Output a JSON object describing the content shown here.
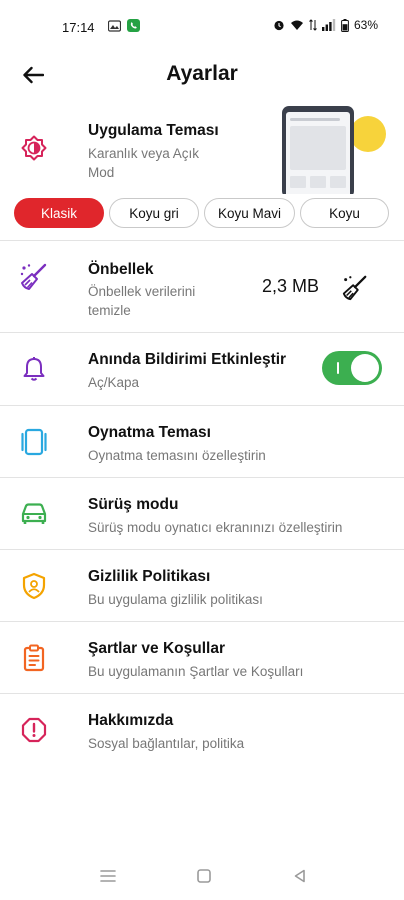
{
  "status_bar": {
    "time": "17:14",
    "battery": "63%"
  },
  "header": {
    "title": "Ayarlar"
  },
  "theme": {
    "title": "Uygulama Teması",
    "subtitle": "Karanlık veya Açık Mod",
    "options": [
      "Klasik",
      "Koyu gri",
      "Koyu Mavi",
      "Koyu"
    ],
    "selected": "Klasik"
  },
  "cache": {
    "title": "Önbellek",
    "subtitle": "Önbellek verilerini temizle",
    "size": "2,3 MB"
  },
  "notifications": {
    "title": "Anında Bildirimi Etkinleştir",
    "subtitle": "Aç/Kapa",
    "enabled": true
  },
  "items": [
    {
      "title": "Oynatma Teması",
      "subtitle": "Oynatma temasını özelleştirin",
      "icon": "player-theme-icon",
      "color": "#29a8e0"
    },
    {
      "title": "Sürüş modu",
      "subtitle": "Sürüş modu oynatıcı ekranınızı özelleştirin",
      "icon": "car-icon",
      "color": "#3caf50"
    },
    {
      "title": "Gizlilik Politikası",
      "subtitle": "Bu uygulama gizlilik politikası",
      "icon": "shield-user-icon",
      "color": "#f4a300"
    },
    {
      "title": "Şartlar ve Koşullar",
      "subtitle": "Bu uygulamanın Şartlar ve Koşulları",
      "icon": "clipboard-icon",
      "color": "#f26522"
    },
    {
      "title": "Hakkımızda",
      "subtitle": "Sosyal bağlantılar, politika",
      "icon": "info-octagon-icon",
      "color": "#d6245a"
    }
  ],
  "colors": {
    "accent_red": "#e0262c",
    "toggle_green": "#3caf50",
    "cache_purple": "#7b2fbf",
    "theme_pink": "#d6245a"
  }
}
